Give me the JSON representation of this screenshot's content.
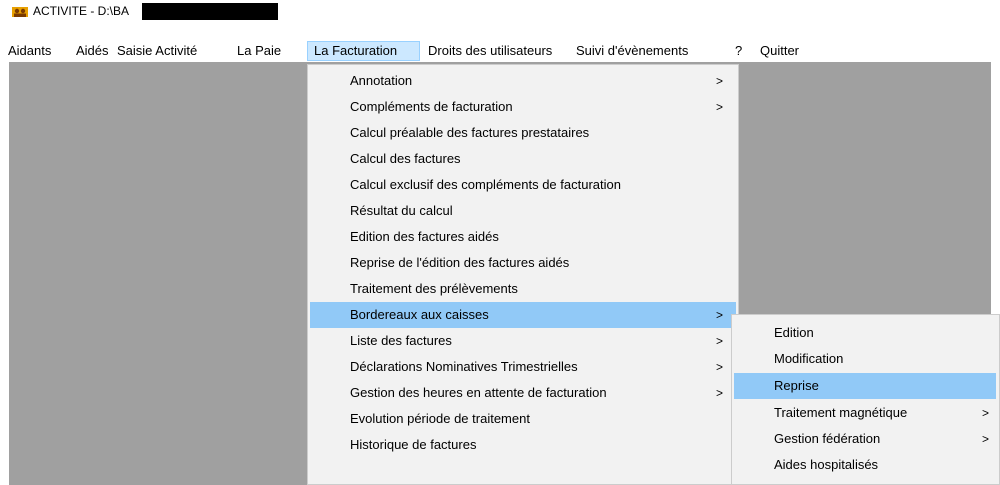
{
  "window": {
    "title": "ACTIVITE - D:\\BA"
  },
  "menubar": {
    "items": [
      {
        "label": "Aidants"
      },
      {
        "label": "Aidés"
      },
      {
        "label": "Saisie Activité"
      },
      {
        "label": "La Paie"
      },
      {
        "label": "La Facturation"
      },
      {
        "label": "Droits des utilisateurs"
      },
      {
        "label": "Suivi d'évènements"
      },
      {
        "label": "?"
      },
      {
        "label": "Quitter"
      }
    ],
    "active": "La Facturation"
  },
  "facturation_menu": {
    "items": [
      {
        "label": "Annotation",
        "submenu": ">"
      },
      {
        "label": "Compléments de facturation",
        "submenu": ">"
      },
      {
        "label": "Calcul préalable des factures prestataires",
        "submenu": ""
      },
      {
        "label": "Calcul des factures",
        "submenu": ""
      },
      {
        "label": "Calcul exclusif des compléments de facturation",
        "submenu": ""
      },
      {
        "label": "Résultat du calcul",
        "submenu": ""
      },
      {
        "label": "Edition des factures aidés",
        "submenu": ""
      },
      {
        "label": "Reprise de l'édition des factures aidés",
        "submenu": ""
      },
      {
        "label": "Traitement des prélèvements",
        "submenu": ""
      },
      {
        "label": "Bordereaux aux caisses",
        "submenu": ">"
      },
      {
        "label": "Liste des factures",
        "submenu": ">"
      },
      {
        "label": "Déclarations Nominatives Trimestrielles",
        "submenu": ">"
      },
      {
        "label": "Gestion des heures en attente de facturation",
        "submenu": ">"
      },
      {
        "label": "Evolution période de traitement",
        "submenu": ""
      },
      {
        "label": "Historique de factures",
        "submenu": ""
      }
    ],
    "highlighted": "Bordereaux aux caisses"
  },
  "bordereaux_submenu": {
    "items": [
      {
        "label": "Edition",
        "submenu": ""
      },
      {
        "label": "Modification",
        "submenu": ""
      },
      {
        "label": "Reprise",
        "submenu": ""
      },
      {
        "label": "Traitement magnétique",
        "submenu": ">"
      },
      {
        "label": "Gestion fédération",
        "submenu": ">"
      },
      {
        "label": "Aides hospitalisés",
        "submenu": ""
      }
    ],
    "highlighted": "Reprise"
  },
  "colors": {
    "client_area": "#a0a0a0",
    "menu_background": "#f2f2f2",
    "menu_highlight": "#91c9f7",
    "menubar_active": "#cce8ff"
  }
}
